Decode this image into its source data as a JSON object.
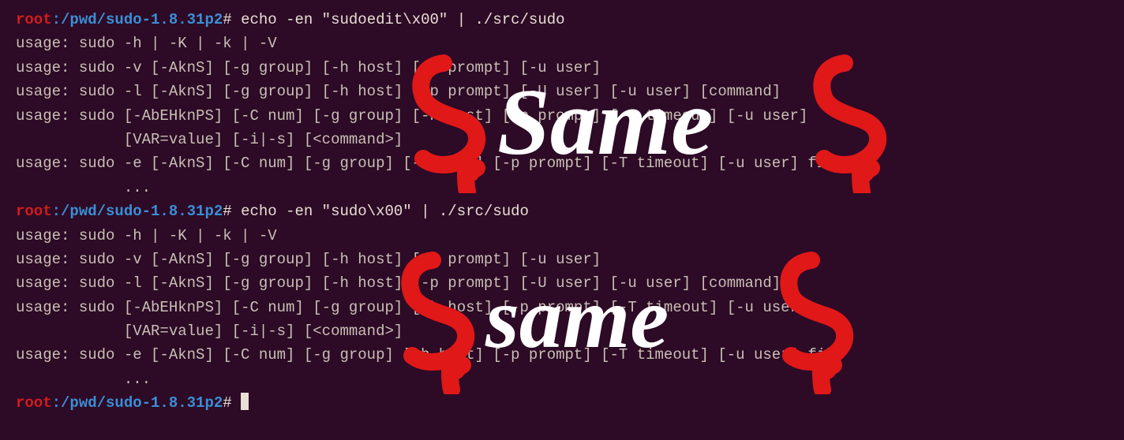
{
  "prompt": {
    "user": "root",
    "colon": ":",
    "path": "/pwd/sudo-1.8.31p2",
    "hash": "# "
  },
  "cmd1": "echo -en \"sudoedit\\x00\" | ./src/sudo",
  "cmd2": "echo -en \"sudo\\x00\" | ./src/sudo",
  "output": {
    "l1": "usage: sudo -h | -K | -k | -V",
    "l2": "usage: sudo -v [-AknS] [-g group] [-h host] [-p prompt] [-u user]",
    "l3": "usage: sudo -l [-AknS] [-g group] [-h host] [-p prompt] [-U user] [-u user] [command]",
    "l4": "usage: sudo [-AbEHknPS] [-C num] [-g group] [-h host] [-p prompt] [-T timeout] [-u user]",
    "l5": "            [VAR=value] [-i|-s] [<command>]",
    "l6": "usage: sudo -e [-AknS] [-C num] [-g group] [-h host] [-p prompt] [-T timeout] [-u user] file",
    "l7": "            ..."
  },
  "annotation": {
    "top": "Same",
    "bottom": "same"
  }
}
